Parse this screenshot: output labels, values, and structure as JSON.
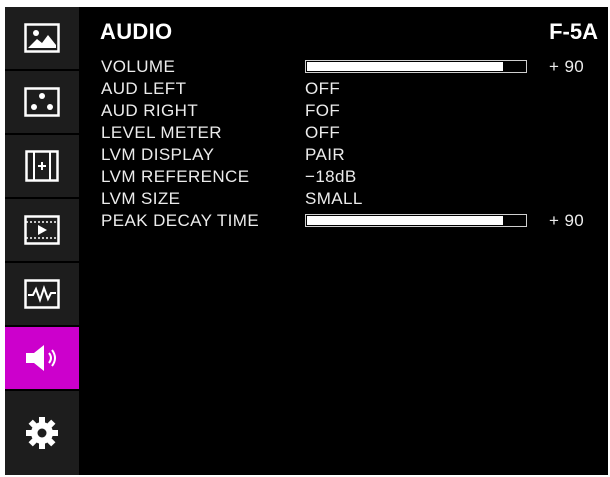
{
  "menu": {
    "title": "AUDIO",
    "model": "F-5A"
  },
  "sidebar": {
    "tabs": [
      {
        "icon": "picture-icon",
        "active": false
      },
      {
        "icon": "dots-icon",
        "active": false
      },
      {
        "icon": "marker-icon",
        "active": false
      },
      {
        "icon": "film-icon",
        "active": false
      },
      {
        "icon": "waveform-icon",
        "active": false
      },
      {
        "icon": "speaker-icon",
        "active": true
      },
      {
        "icon": "gear-icon",
        "active": false
      }
    ],
    "active_color": "#cc00cc"
  },
  "settings": {
    "volume": {
      "label": "VOLUME",
      "value": "+ 90",
      "level": 0.9
    },
    "aud_left": {
      "label": "AUD LEFT",
      "value": "OFF"
    },
    "aud_right": {
      "label": "AUD RIGHT",
      "value": "FOF"
    },
    "level_meter": {
      "label": "LEVEL METER",
      "value": "OFF"
    },
    "lvm_display": {
      "label": "LVM DISPLAY",
      "value": "PAIR"
    },
    "lvm_reference": {
      "label": "LVM REFERENCE",
      "value": "−18dB"
    },
    "lvm_size": {
      "label": "LVM SIZE",
      "value": "SMALL"
    },
    "peak_decay_time": {
      "label": "PEAK DECAY TIME",
      "value": "+ 90",
      "level": 0.9
    }
  }
}
